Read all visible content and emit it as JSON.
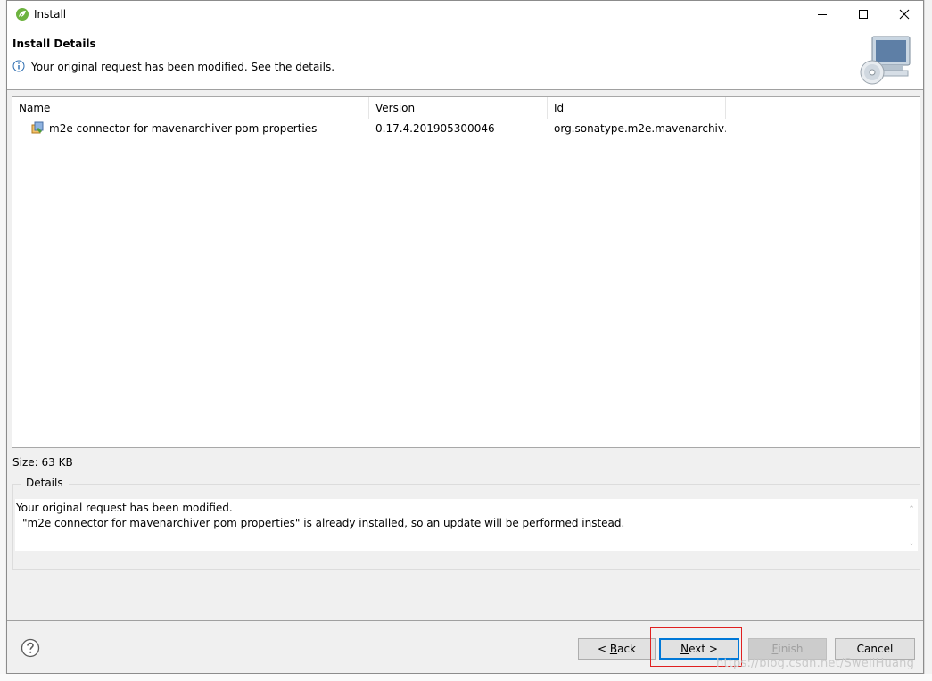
{
  "window": {
    "title": "Install",
    "controls": {
      "minimize": "minimize",
      "maximize": "maximize",
      "close": "close"
    }
  },
  "header": {
    "page_title": "Install Details",
    "info_message": "Your original request has been modified.  See the details."
  },
  "table": {
    "columns": [
      "Name",
      "Version",
      "Id"
    ],
    "rows": [
      {
        "name": "m2e connector for mavenarchiver pom properties",
        "version": "0.17.4.201905300046",
        "id": "org.sonatype.m2e.mavenarchiv…"
      }
    ]
  },
  "size": "Size: 63 KB",
  "details": {
    "legend": "Details",
    "line1": "Your original request has been modified.",
    "line2": "\"m2e connector for mavenarchiver pom properties\" is already installed, so an update will be performed instead."
  },
  "buttons": {
    "back_prefix": "< ",
    "back_mnemonic": "B",
    "back_rest": "ack",
    "next_mnemonic": "N",
    "next_rest": "ext >",
    "finish_mnemonic": "F",
    "finish_rest": "inish",
    "cancel": "Cancel"
  },
  "icons": {
    "app": "spring-leaf-icon",
    "info": "info-icon",
    "banner": "computer-cd-icon",
    "plugin": "plugin-feature-icon",
    "help": "help-icon"
  },
  "colors": {
    "default_button_border": "#0078d7",
    "highlight_box": "#e02020"
  },
  "watermark": "https://blog.csdn.net/SwellHuang"
}
